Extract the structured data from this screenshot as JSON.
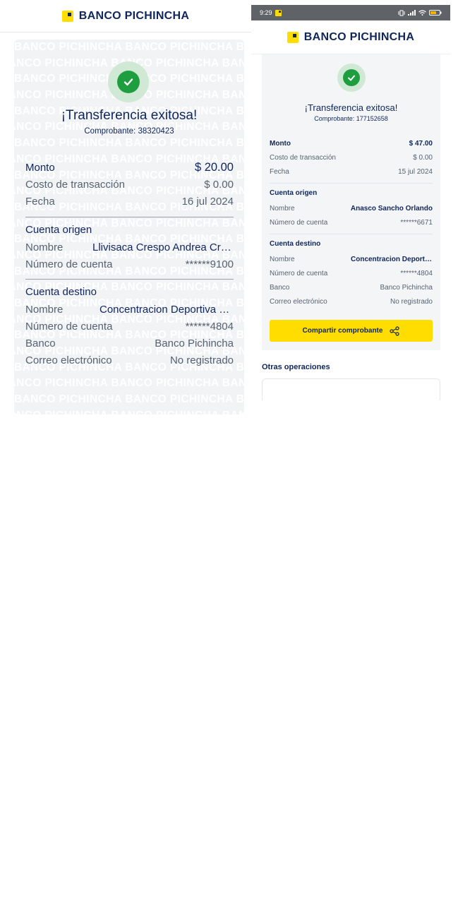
{
  "brand": {
    "name": "BANCO PICHINCHA",
    "accent": "#ffdd00",
    "primary": "#0f265c",
    "success": "#1e9e3f"
  },
  "left": {
    "title": "¡Transferencia exitosa!",
    "receipt_label": "Comprobante: 38320423",
    "watermark_text": "BANCO PICHINCHA",
    "rows_summary": [
      {
        "label": "Monto",
        "value": "$ 20.00"
      },
      {
        "label": "Costo de transacción",
        "value": "$ 0.00"
      },
      {
        "label": "Fecha",
        "value": "16 jul 2024"
      }
    ],
    "origin": {
      "section": "Cuenta origen",
      "rows": [
        {
          "label": "Nombre",
          "value": "Llivisaca  Crespo Andrea Cristina"
        },
        {
          "label": "Número de cuenta",
          "value": "******9100"
        }
      ]
    },
    "destination": {
      "section": "Cuenta destino",
      "rows": [
        {
          "label": "Nombre",
          "value": "Concentracion Deportiva de Pichincha"
        },
        {
          "label": "Número de cuenta",
          "value": "******4804"
        },
        {
          "label": "Banco",
          "value": "Banco Pichincha"
        },
        {
          "label": "Correo electrónico",
          "value": "No registrado"
        }
      ]
    }
  },
  "right": {
    "status_time": "9:29",
    "title": "¡Transferencia exitosa!",
    "receipt_label": "Comprobante: 177152658",
    "rows_summary": [
      {
        "label": "Monto",
        "value": "$ 47.00"
      },
      {
        "label": "Costo de transacción",
        "value": "$ 0.00"
      },
      {
        "label": "Fecha",
        "value": "15 jul 2024"
      }
    ],
    "origin": {
      "section": "Cuenta origen",
      "rows": [
        {
          "label": "Nombre",
          "value": "Anasco  Sancho Orlando"
        },
        {
          "label": "Número de cuenta",
          "value": "******6671"
        }
      ]
    },
    "destination": {
      "section": "Cuenta destino",
      "rows": [
        {
          "label": "Nombre",
          "value": "Concentracion Deportiva de Pichincha"
        },
        {
          "label": "Número de cuenta",
          "value": "******4804"
        },
        {
          "label": "Banco",
          "value": "Banco Pichincha"
        },
        {
          "label": "Correo electrónico",
          "value": "No registrado"
        }
      ]
    },
    "share_button": "Compartir comprobante",
    "other_ops": "Otras operaciones"
  }
}
